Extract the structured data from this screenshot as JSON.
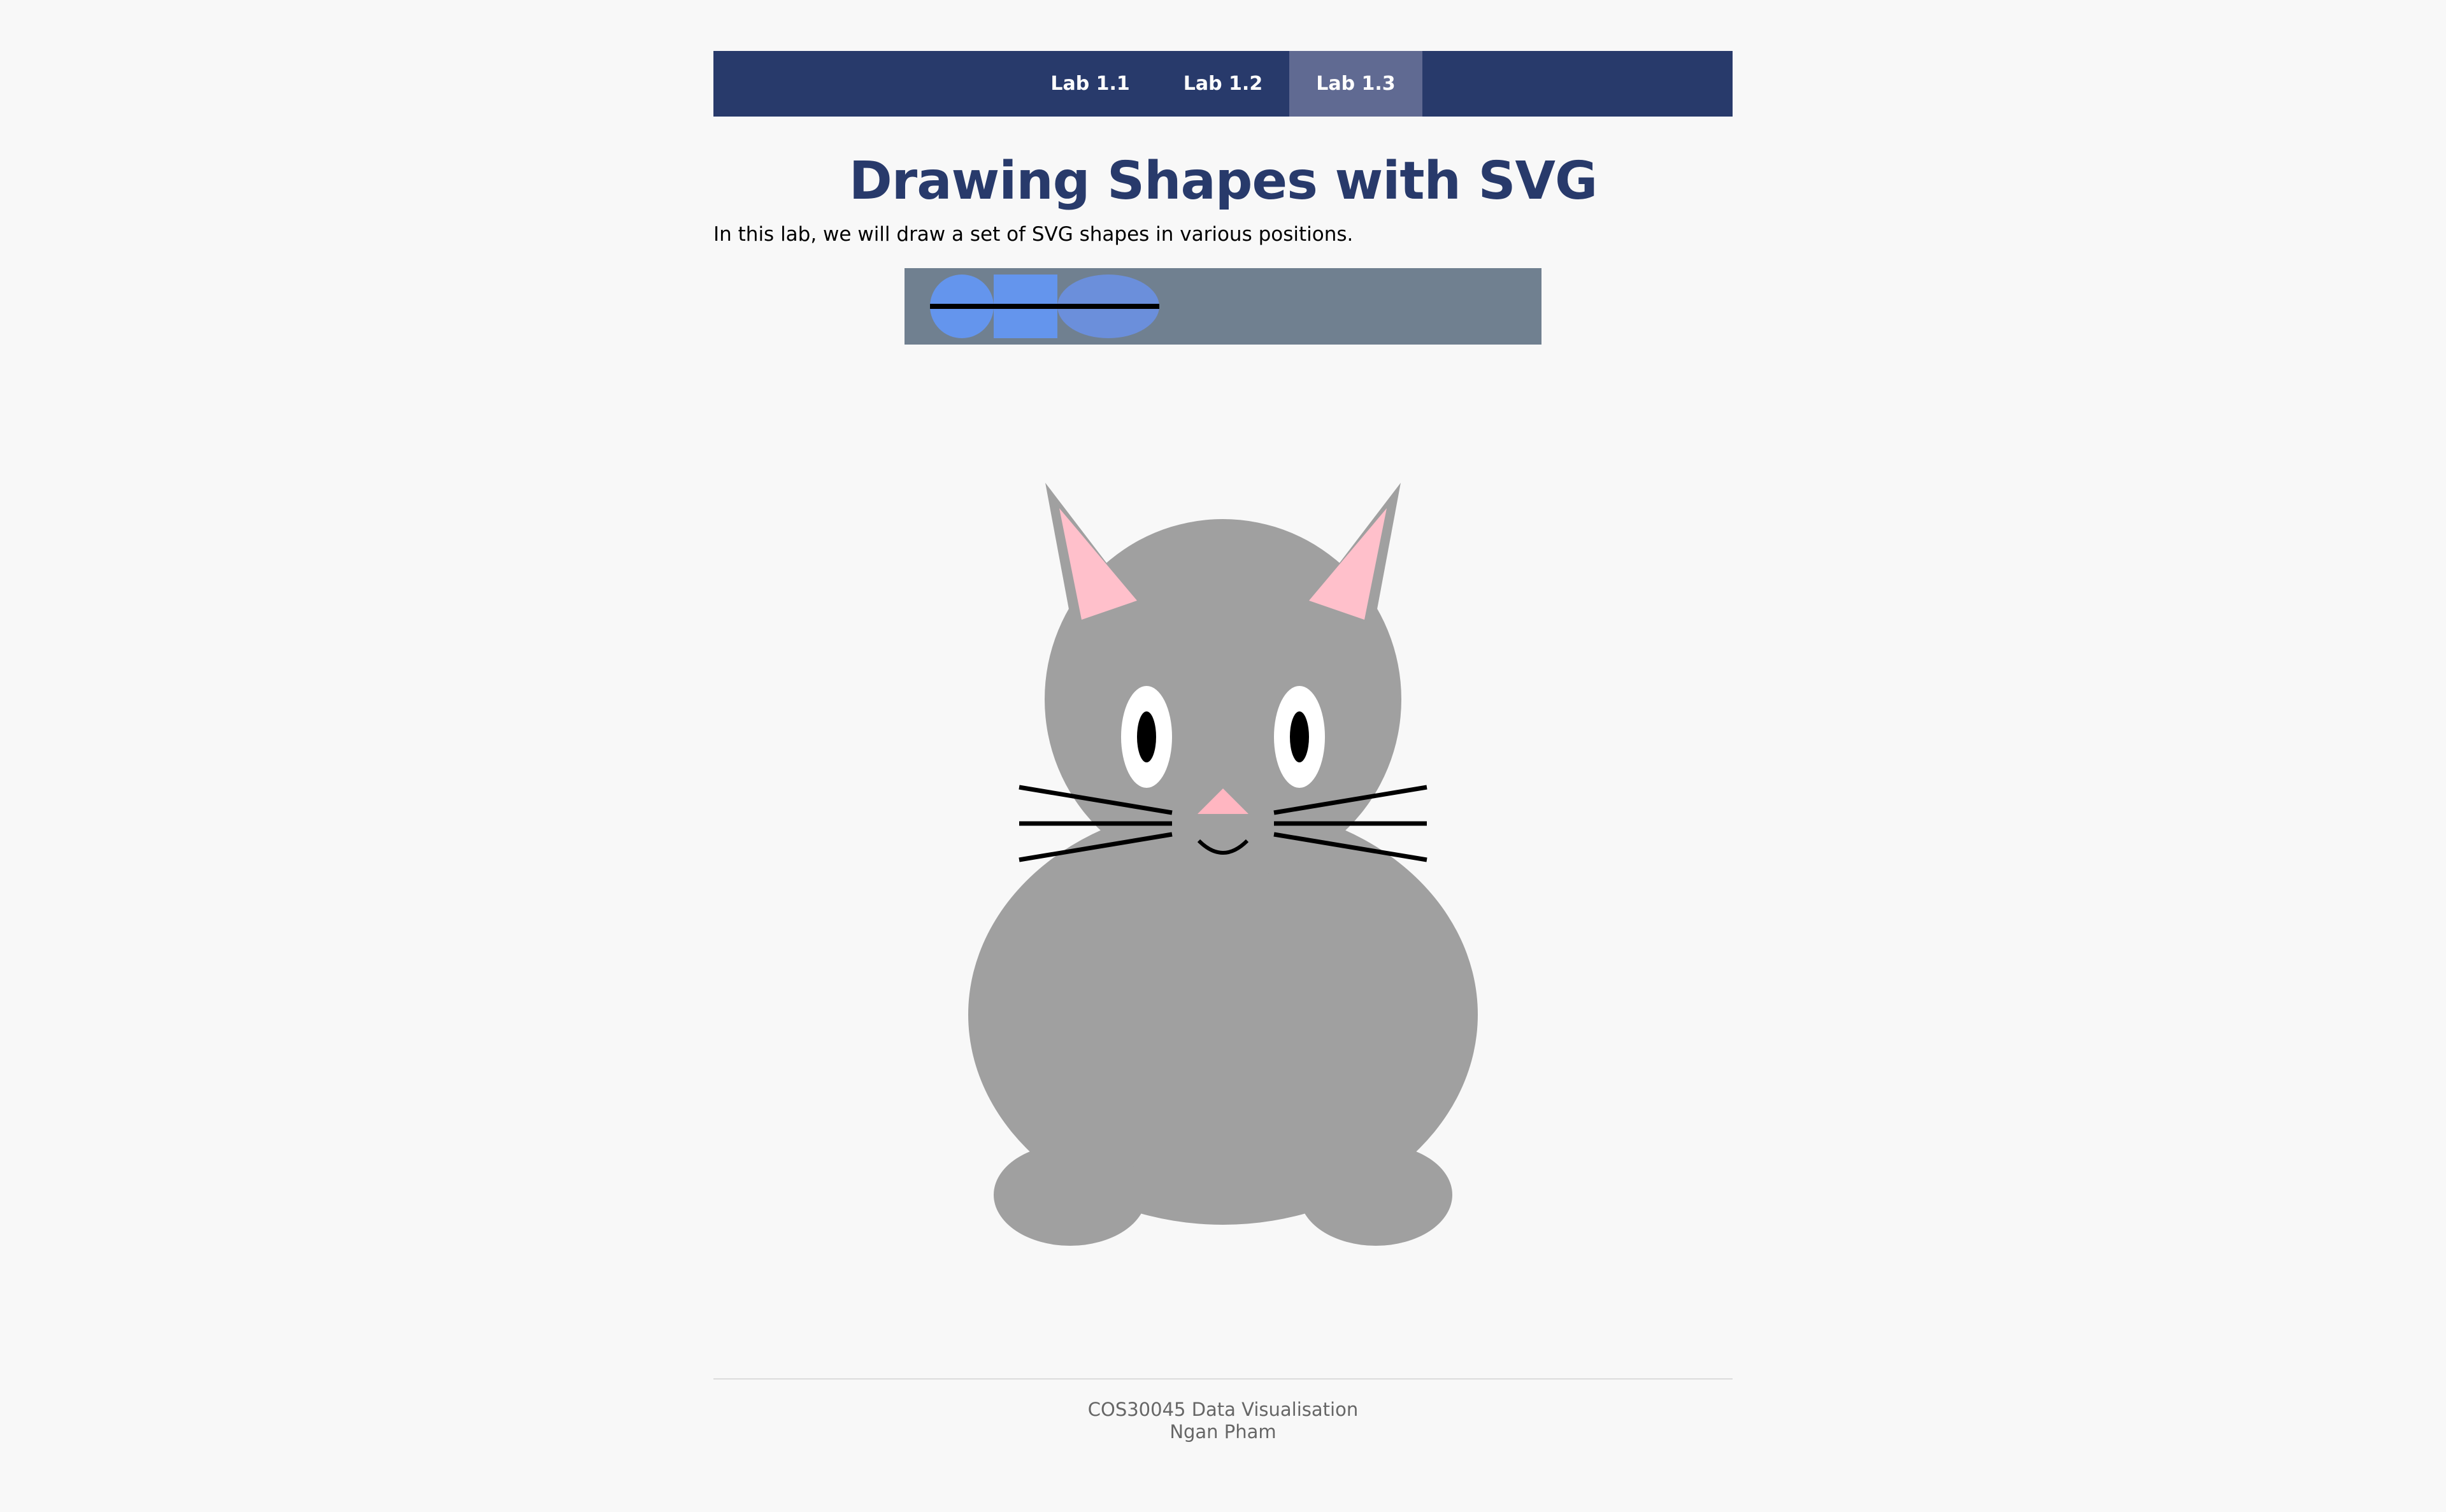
{
  "nav": {
    "items": [
      {
        "label": "Lab 1.1",
        "active": false
      },
      {
        "label": "Lab 1.2",
        "active": false
      },
      {
        "label": "Lab 1.3",
        "active": true
      }
    ]
  },
  "page": {
    "title": "Drawing Shapes with SVG",
    "intro": "In this lab, we will draw a set of SVG shapes in various positions."
  },
  "shapes": {
    "background_color": "#708090",
    "circle_color": "#6495ed",
    "rect_color": "#6495ed",
    "ellipse_color": "#6b8fdb",
    "line_color": "#000000"
  },
  "cat": {
    "body_color": "#a0a0a0",
    "ear_outer_color": "#a0a0a0",
    "ear_inner_color": "#ffc0cb",
    "nose_color": "#ffb6c1",
    "eye_white": "#ffffff",
    "pupil_color": "#000000",
    "whisker_color": "#000000"
  },
  "footer": {
    "course": "COS30045 Data Visualisation",
    "author": "Ngan Pham"
  }
}
